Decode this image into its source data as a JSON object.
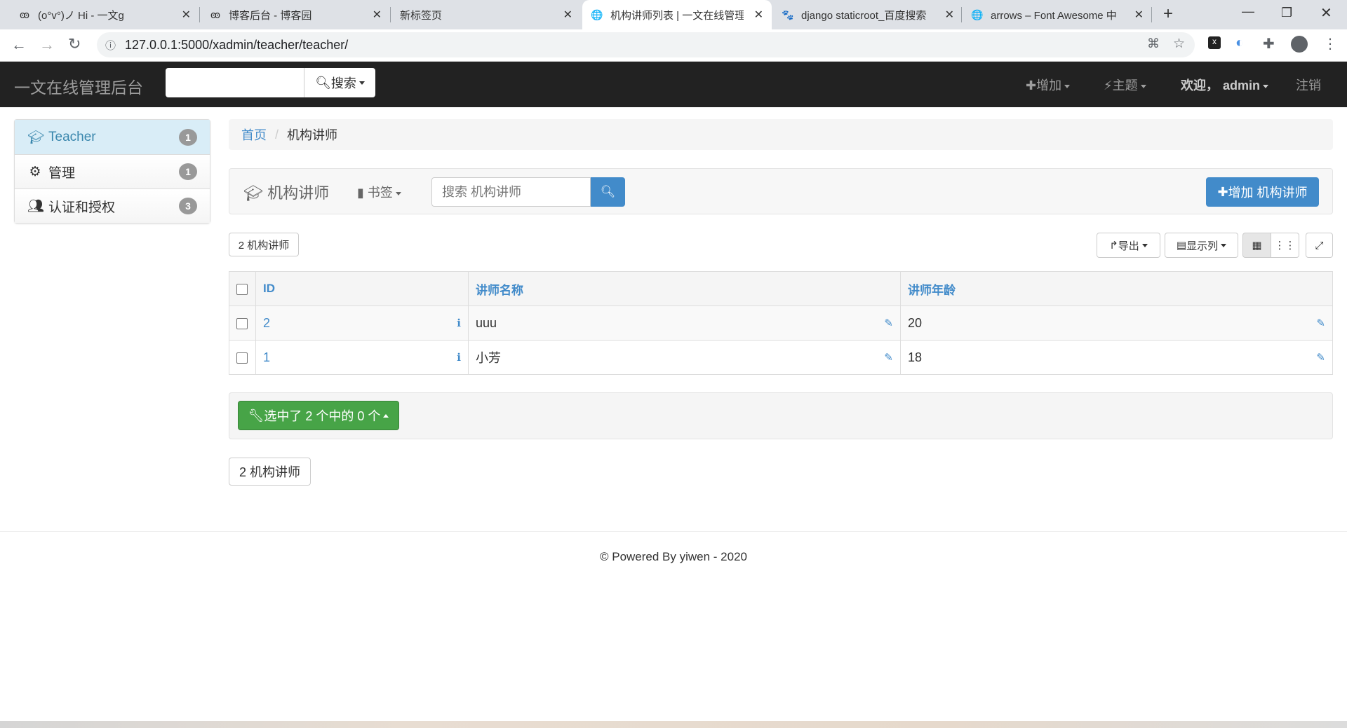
{
  "browser": {
    "tabs": [
      {
        "title": "(o°v°)ノ Hi - 一文g",
        "icon": "blog-icon"
      },
      {
        "title": "博客后台 - 博客园",
        "icon": "blog-icon"
      },
      {
        "title": "新标签页",
        "icon": ""
      },
      {
        "title": "机构讲师列表 | 一文在线管理",
        "icon": "globe-icon"
      },
      {
        "title": "django staticroot_百度搜索",
        "icon": "baidu-paw-icon"
      },
      {
        "title": "arrows – Font Awesome 中",
        "icon": "globe-icon"
      }
    ],
    "new_tab": "+",
    "url": "127.0.0.1:5000/xadmin/teacher/teacher/"
  },
  "navbar": {
    "brand": "一文在线管理后台",
    "search_button": "搜索",
    "add": "增加",
    "theme": "主题",
    "welcome": "欢迎，",
    "user": "admin",
    "logout": "注销"
  },
  "sidebar": {
    "items": [
      {
        "label": "Teacher",
        "count": "1",
        "icon": "graduation-cap-icon"
      },
      {
        "label": "管理",
        "count": "1",
        "icon": "gear-icon"
      },
      {
        "label": "认证和授权",
        "count": "3",
        "icon": "users-icon"
      }
    ]
  },
  "breadcrumb": {
    "home": "首页",
    "current": "机构讲师"
  },
  "toolbar": {
    "title": "机构讲师",
    "bookmark": "书签",
    "search_placeholder": "搜索 机构讲师",
    "add_button": "增加 机构讲师"
  },
  "list": {
    "count_label": "2 机构讲师",
    "export": "导出",
    "columns_button": "显示列"
  },
  "table": {
    "headers": [
      "ID",
      "讲师名称",
      "讲师年龄"
    ],
    "rows": [
      {
        "id": "2",
        "name": "uuu",
        "age": "20"
      },
      {
        "id": "1",
        "name": "小芳",
        "age": "18"
      }
    ]
  },
  "actions": {
    "selected": "选中了 2 个中的 0 个"
  },
  "footer": {
    "text": "© Powered By yiwen - 2020"
  },
  "colors": {
    "primary": "#428bca",
    "success": "#47a447",
    "navbar": "#222222"
  }
}
